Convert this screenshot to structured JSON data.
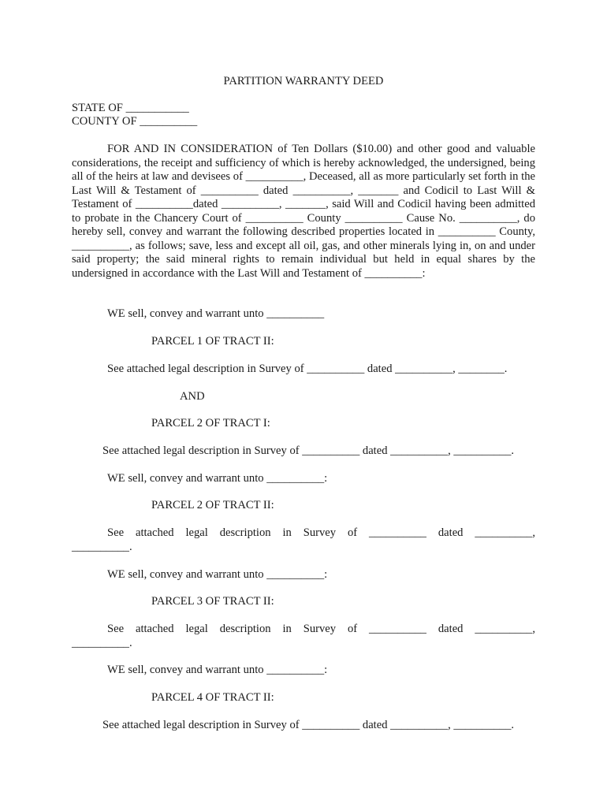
{
  "document": {
    "title": "PARTITION WARRANTY DEED",
    "state_line": "STATE OF ___________",
    "county_line": "COUNTY OF __________",
    "consideration_paragraph": "FOR AND IN CONSIDERATION of Ten Dollars ($10.00) and other good and valuable considerations, the receipt and sufficiency of which is hereby acknowledged, the undersigned, being all of the heirs at law and devisees of __________, Deceased, all as more particularly set forth in the Last Will & Testament of __________ dated __________, _______ and Codicil to Last Will & Testament of __________dated __________, _______, said Will and Codicil having been admitted to probate in the Chancery Court of __________ County __________ Cause No. __________, do hereby sell, convey and warrant the following described properties located in __________ County, __________, as follows; save, less and except all oil, gas, and other minerals lying in, on and under said property; the said mineral rights to remain individual but held in equal shares by the undersigned in accordance with the Last Will and Testament of __________:",
    "sections": [
      {
        "convey": "WE sell, convey and warrant unto __________"
      },
      {
        "parcel": "PARCEL 1 OF TRACT II:"
      },
      {
        "desc": "See attached legal description in Survey of __________ dated __________, ________."
      },
      {
        "and": "AND"
      },
      {
        "parcel": "PARCEL 2 OF TRACT I:"
      },
      {
        "desc": "See attached legal description in Survey of __________ dated __________, __________."
      },
      {
        "convey": "WE sell, convey and warrant unto __________:"
      },
      {
        "parcel": "PARCEL 2 OF TRACT II:"
      },
      {
        "desc_line1": "See attached legal description in Survey of __________ dated __________,",
        "desc_line2": "__________."
      },
      {
        "convey": "WE sell, convey and warrant unto __________:"
      },
      {
        "parcel": "PARCEL 3 OF TRACT II:"
      },
      {
        "desc_line1": "See attached legal description in Survey of __________ dated __________,",
        "desc_line2": "__________."
      },
      {
        "convey": "WE sell, convey and warrant unto __________:"
      },
      {
        "parcel": "PARCEL 4 OF TRACT II:"
      },
      {
        "desc": "See attached legal description in Survey of __________ dated __________, __________."
      }
    ]
  }
}
